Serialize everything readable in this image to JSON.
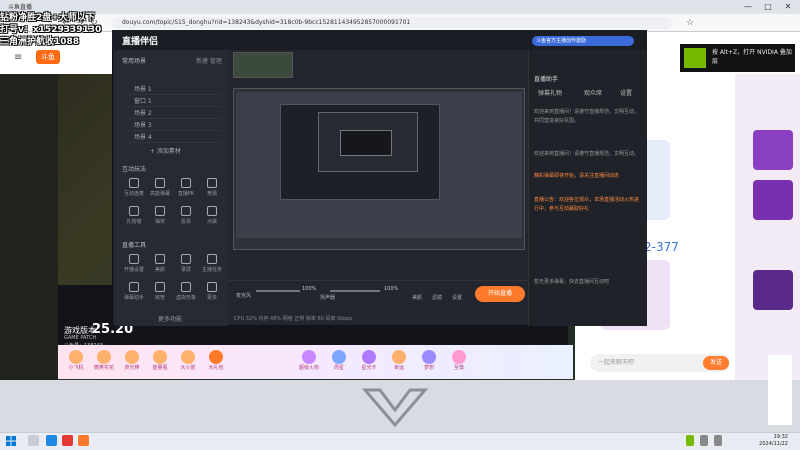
{
  "browser": {
    "tab_title": "斗鱼直播",
    "url": "douyu.com/topic/S15_donghu?rid=138243&dyshid=318c0b-9bcc152811434952857000091701",
    "back_label": "←",
    "forward_label": "→",
    "refresh_label": "↻",
    "home_label": "⌂",
    "minimize_label": "—",
    "maximize_label": "□",
    "close_label": "✕"
  },
  "watermark": {
    "line1": "钻粉净胜2盘+大师以下",
    "line2": "打号v：x1529339130",
    "line3": "三角洲护航收1088"
  },
  "site": {
    "logo_text": "斗鱼",
    "stream_badge_title": "游戏版本",
    "stream_badge_number": "25.20",
    "stream_badge_sub": "GAME PATCH",
    "room_id": "斗鱼号：138243",
    "gifts": [
      "小飞机",
      "微笑花花",
      "荧光棒",
      "能量瓶",
      "大火箭",
      "大礼包",
      "超级火箭",
      "周星",
      "星光卡",
      "幸运",
      "梦想",
      "至尊"
    ],
    "rank_number": "2-377",
    "chat_placeholder": "一起来聊天吧",
    "send_label": "发送"
  },
  "nvidia": {
    "text": "按 Alt+Z，打开 NVIDIA 叠加层"
  },
  "companion_app": {
    "title": "直播伴侣",
    "left": {
      "scene_header": "常用场景",
      "scene_actions": "新建 管理",
      "scenes": [
        "场景 1",
        "窗口 1",
        "场景 2",
        "场景 3",
        "场景 4"
      ],
      "add_source": "+ 添加素材",
      "tools_header": "互动玩法",
      "tools": [
        "互动连麦",
        "高能弹幕",
        "直播PK",
        "竞猜",
        "礼物墙",
        "抽奖",
        "投票",
        "点歌"
      ],
      "live_tools_header": "直播工具",
      "live_tools": [
        "开播设置",
        "美颜",
        "录屏",
        "主播任务",
        "弹幕助手",
        "房管",
        "虚拟形象",
        "更多"
      ],
      "more_label": "更多功能"
    },
    "bottom": {
      "mic_label": "麦克风",
      "speaker_label": "扬声器",
      "volume_mic": "100%",
      "volume_spk": "100%",
      "volume_other": "100%",
      "tools": [
        "美颜",
        "滤镜",
        "设置"
      ],
      "start_label": "开始直播",
      "status": "CPU 32%   内存 48%   网络 正常   帧率 60   码率 0kbps"
    },
    "right": {
      "header": "直播助手",
      "tabs": [
        "弹幕礼物",
        "观众席",
        "设置"
      ],
      "douyu_pill": "斗鱼官方主播创作激励",
      "note1": "欢迎来到直播间！请遵守直播规范，文明互动，共同营造良好氛围。",
      "note2": "欢迎来到直播间！请遵守直播规范，文明互动。",
      "note_orange1": "精彩弹幕即将开始，请关注直播间动态",
      "note_orange2": "直播公告：欢迎各位观众，本场直播活动火热进行中，参与互动赢取好礼",
      "footer": "暂无更多弹幕，快去直播间互动吧"
    }
  },
  "taskbar": {
    "time": "19:32",
    "date": "2024/11/22"
  }
}
